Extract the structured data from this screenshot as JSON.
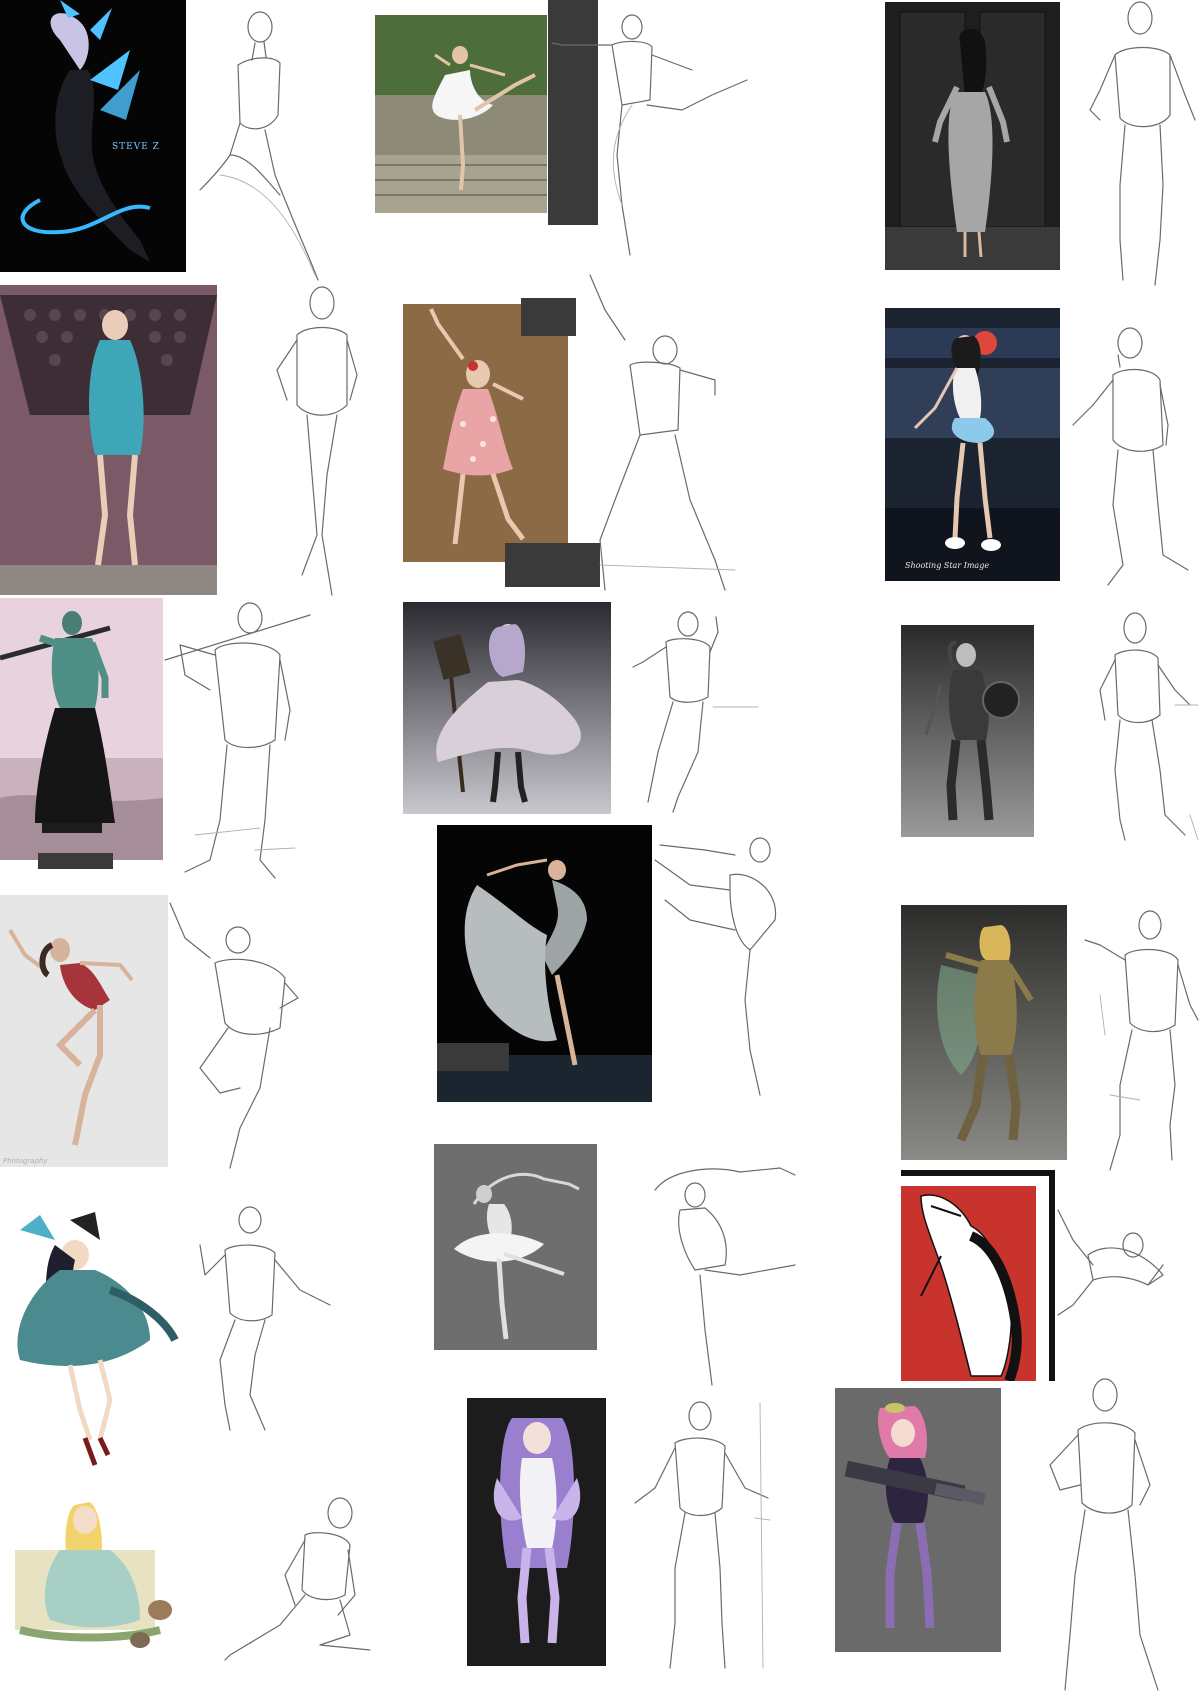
{
  "labels": {
    "watermark_top_left": "STEVE Z",
    "signature_cheongsam": "",
    "signature_club": "Shooting Star Image",
    "credit_dancer": "Photography",
    "credit_fantasy": "",
    "signature_red": ""
  },
  "colors": {
    "background": "#ffffff",
    "sketch_line": "#6a6a6a",
    "block": "#3a3a3a",
    "accent_blue": "#4fc3ff",
    "accent_red": "#c8332d"
  }
}
